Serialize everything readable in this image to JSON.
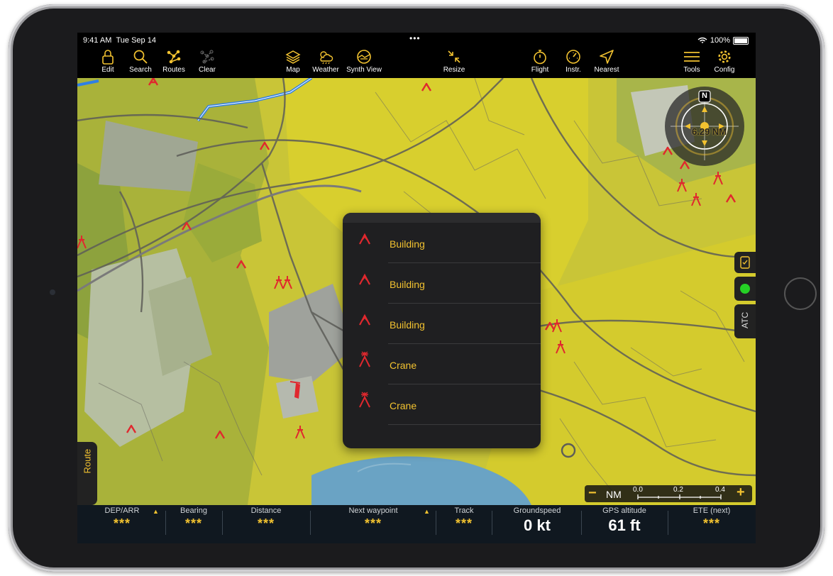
{
  "status_bar": {
    "time": "9:41 AM",
    "date": "Tue Sep 14",
    "battery": "100%",
    "dots": "•••"
  },
  "toolbar": {
    "items": [
      {
        "label": "Edit",
        "icon": "lock-icon"
      },
      {
        "label": "Search",
        "icon": "search-icon"
      },
      {
        "label": "Routes",
        "icon": "routes-icon"
      },
      {
        "label": "Clear",
        "icon": "clear-icon"
      },
      {
        "label": "Map",
        "icon": "layers-icon"
      },
      {
        "label": "Weather",
        "icon": "weather-icon"
      },
      {
        "label": "Synth View",
        "icon": "synth-view-icon"
      },
      {
        "label": "Resize",
        "icon": "resize-icon"
      },
      {
        "label": "Flight",
        "icon": "stopwatch-icon"
      },
      {
        "label": "Instr.",
        "icon": "gauge-icon"
      },
      {
        "label": "Nearest",
        "icon": "nearest-icon"
      },
      {
        "label": "Tools",
        "icon": "menu-icon"
      },
      {
        "label": "Config",
        "icon": "gear-icon"
      }
    ]
  },
  "popup": {
    "items": [
      {
        "label": "Building",
        "icon": "building-obstacle-icon"
      },
      {
        "label": "Building",
        "icon": "building-obstacle-icon"
      },
      {
        "label": "Building",
        "icon": "building-obstacle-icon"
      },
      {
        "label": "Crane",
        "icon": "crane-obstacle-icon"
      },
      {
        "label": "Crane",
        "icon": "crane-obstacle-icon"
      }
    ]
  },
  "side_tab": {
    "label": "Route"
  },
  "right_panel": {
    "atc_label": "ATC"
  },
  "compass": {
    "north_label": "N",
    "range_label": "6.29 NM"
  },
  "scale": {
    "unit": "NM",
    "minus": "−",
    "plus": "+",
    "ticks": [
      "0.0",
      "0.2",
      "0.4"
    ]
  },
  "bottom_bar": {
    "cells": [
      {
        "header": "DEP/ARR",
        "value": "***"
      },
      {
        "header": "Bearing",
        "value": "***"
      },
      {
        "header": "Distance",
        "value": "***"
      },
      {
        "header": "Next waypoint",
        "value": "***"
      },
      {
        "header": "Track",
        "value": "***"
      },
      {
        "header": "Groundspeed",
        "value": "0 kt"
      },
      {
        "header": "GPS altitude",
        "value": "61 ft"
      },
      {
        "header": "ETE (next)",
        "value": "***"
      }
    ]
  },
  "colors": {
    "accent": "#f2c230",
    "obstacle": "#e0282e",
    "map_yellow": "#c8c93a",
    "map_green": "#8fa83c",
    "water": "#6aa3c4",
    "road": "#5a5a5a"
  }
}
